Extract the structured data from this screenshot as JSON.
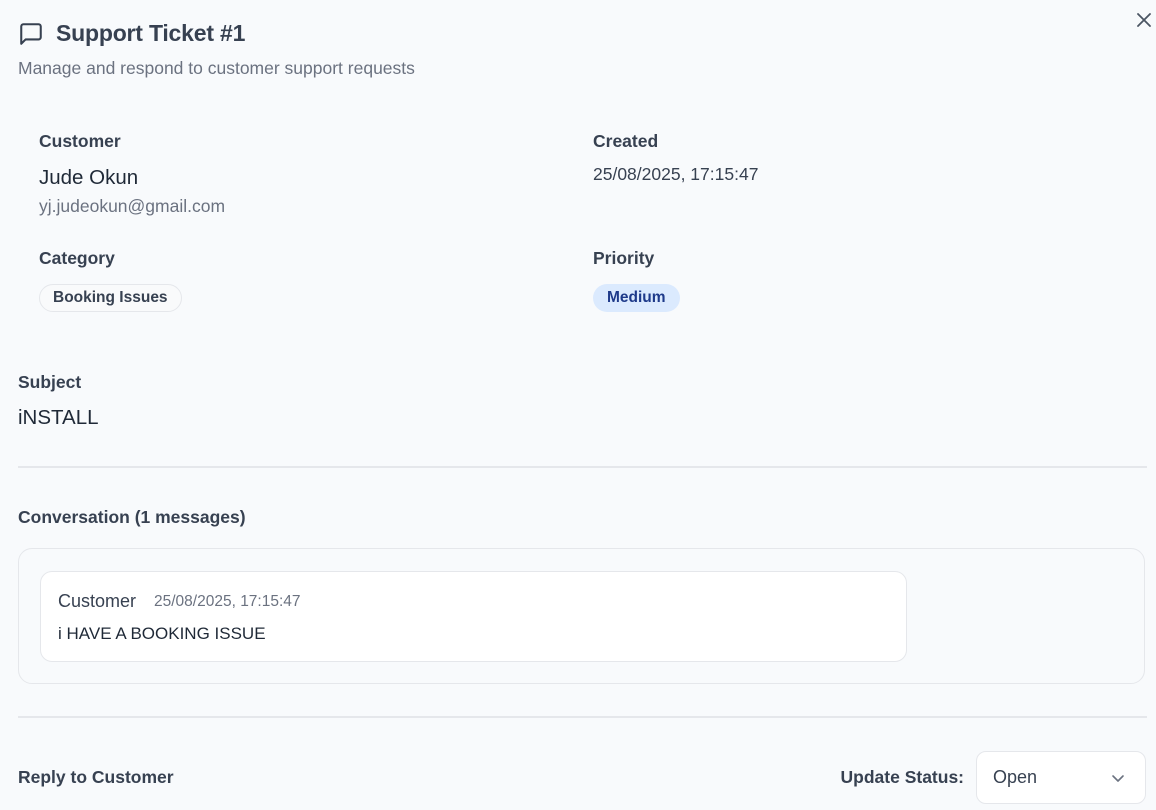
{
  "header": {
    "title": "Support Ticket #1",
    "subtitle": "Manage and respond to customer support requests",
    "icon": "message-square-icon",
    "close_icon": "close-icon"
  },
  "details": {
    "customer_label": "Customer",
    "customer_name": "Jude Okun",
    "customer_email": "yj.judeokun@gmail.com",
    "created_label": "Created",
    "created_value": "25/08/2025, 17:15:47",
    "category_label": "Category",
    "category_value": "Booking Issues",
    "priority_label": "Priority",
    "priority_value": "Medium"
  },
  "subject": {
    "label": "Subject",
    "value": "iNSTALL"
  },
  "conversation": {
    "title": "Conversation (1 messages)",
    "messages": [
      {
        "sender": "Customer",
        "timestamp": "25/08/2025, 17:15:47",
        "body": "i HAVE A BOOKING ISSUE"
      }
    ]
  },
  "reply": {
    "title": "Reply to Customer",
    "status_label": "Update Status:",
    "status_value": "Open"
  },
  "colors": {
    "priority_bg": "#dbeafe",
    "priority_text": "#1e3a8a",
    "background": "#f8fafc"
  }
}
